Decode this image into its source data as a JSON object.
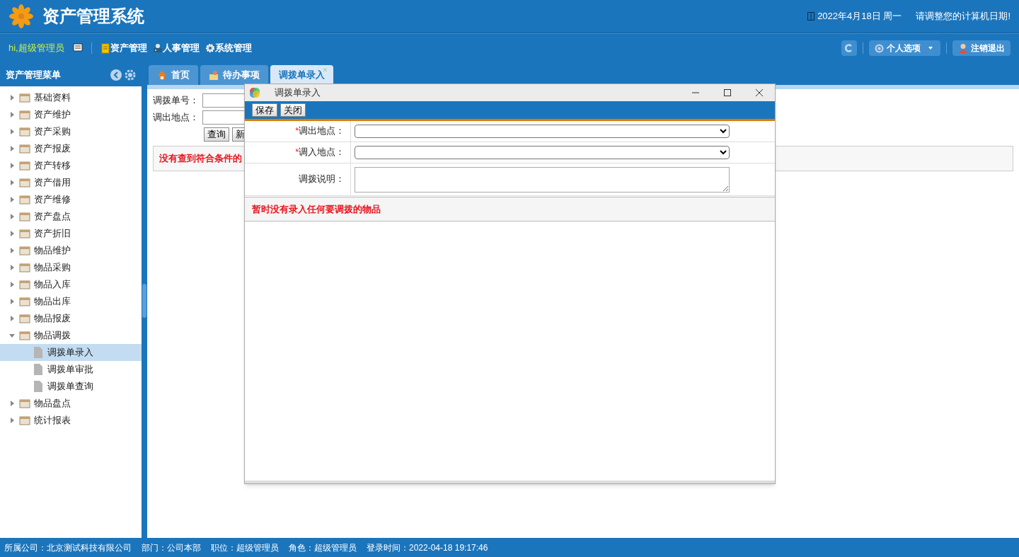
{
  "app": {
    "title": "资产管理系统",
    "date": "2022年4月18日 周一",
    "notice": "请调整您的计算机日期!"
  },
  "nav": {
    "greeting": "hi,超级管理员",
    "modules": [
      "资产管理",
      "人事管理",
      "系统管理"
    ],
    "profile": "个人选项",
    "logout": "注销退出"
  },
  "sidebar": {
    "title": "资产管理菜单",
    "items": [
      {
        "label": "基础资料",
        "expanded": false
      },
      {
        "label": "资产维护",
        "expanded": false
      },
      {
        "label": "资产采购",
        "expanded": false
      },
      {
        "label": "资产报废",
        "expanded": false
      },
      {
        "label": "资产转移",
        "expanded": false
      },
      {
        "label": "资产借用",
        "expanded": false
      },
      {
        "label": "资产维修",
        "expanded": false
      },
      {
        "label": "资产盘点",
        "expanded": false
      },
      {
        "label": "资产折旧",
        "expanded": false
      },
      {
        "label": "物品维护",
        "expanded": false
      },
      {
        "label": "物品采购",
        "expanded": false
      },
      {
        "label": "物品入库",
        "expanded": false
      },
      {
        "label": "物品出库",
        "expanded": false
      },
      {
        "label": "物品报废",
        "expanded": false
      },
      {
        "label": "物品调拨",
        "expanded": true,
        "children": [
          {
            "label": "调拨单录入",
            "selected": true
          },
          {
            "label": "调拨单审批",
            "selected": false
          },
          {
            "label": "调拨单查询",
            "selected": false
          }
        ]
      },
      {
        "label": "物品盘点",
        "expanded": false
      },
      {
        "label": "统计报表",
        "expanded": false
      }
    ]
  },
  "tabs": [
    {
      "label": "首页",
      "selected": false
    },
    {
      "label": "待办事项",
      "selected": false
    },
    {
      "label": "调拨单录入",
      "selected": true,
      "close": "×"
    }
  ],
  "search_form": {
    "fields": [
      "调拨单号：",
      "调出地点："
    ],
    "buttons": [
      "查询",
      "新"
    ],
    "message": "没有查到符合条件的"
  },
  "dialog": {
    "title": "调拨单录入",
    "buttons": [
      "保存",
      "关闭"
    ],
    "fields": [
      {
        "label": "调出地点：",
        "required": true,
        "kind": "select"
      },
      {
        "label": "调入地点：",
        "required": true,
        "kind": "select"
      },
      {
        "label": "调拨说明：",
        "required": false,
        "kind": "textarea"
      }
    ],
    "required_mark": "*",
    "message": "暂时没有录入任何要调拨的物品"
  },
  "status_bar": [
    "所属公司：北京测试科技有限公司",
    "部门：公司本部",
    "职位：超级管理员",
    "角色：超级管理员",
    "登录时间：2022-04-18 19:17:46"
  ]
}
